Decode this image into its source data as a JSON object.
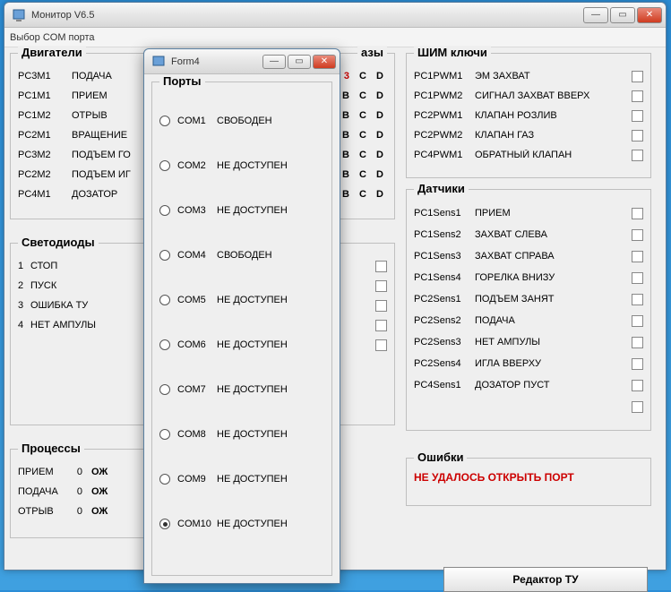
{
  "main": {
    "title": "Монитор  V6.5",
    "menu": {
      "item0": "Выбор COM порта"
    }
  },
  "engines": {
    "legend": "Двигатели",
    "items": [
      {
        "code": "PC3M1",
        "label": "ПОДАЧА"
      },
      {
        "code": "PC1M1",
        "label": "ПРИЕМ"
      },
      {
        "code": "PC1M2",
        "label": "ОТРЫВ"
      },
      {
        "code": "PC2M1",
        "label": "ВРАЩЕНИЕ"
      },
      {
        "code": "PC3M2",
        "label": "ПОДЪЕМ ГО"
      },
      {
        "code": "PC2M2",
        "label": "ПОДЪЕМ ИГ"
      },
      {
        "code": "PC4M1",
        "label": "ДОЗАТОР"
      }
    ]
  },
  "leds": {
    "legend": "Светодиоды",
    "items": [
      {
        "idx": "1",
        "label": "СТОП"
      },
      {
        "idx": "2",
        "label": "ПУСК"
      },
      {
        "idx": "3",
        "label": "ОШИБКА ТУ"
      },
      {
        "idx": "4",
        "label": "НЕТ АМПУЛЫ"
      }
    ]
  },
  "phases": {
    "legend": "азы",
    "row": "B C D",
    "row_first_red": "3 C D"
  },
  "processes": {
    "legend": "Процессы",
    "items": [
      {
        "name": "ПРИЕМ",
        "val": "0",
        "state": "ОЖ"
      },
      {
        "name": "ПОДАЧА",
        "val": "0",
        "state": "ОЖ"
      },
      {
        "name": "ОТРЫВ",
        "val": "0",
        "state": "ОЖ"
      }
    ]
  },
  "pwm": {
    "legend": "ШИМ ключи",
    "items": [
      {
        "code": "PC1PWM1",
        "label": "ЭМ ЗАХВАТ"
      },
      {
        "code": "PC1PWM2",
        "label": "СИГНАЛ ЗАХВАТ ВВЕРХ"
      },
      {
        "code": "PC2PWM1",
        "label": "КЛАПАН РОЗЛИВ"
      },
      {
        "code": "PC2PWM2",
        "label": "КЛАПАН ГАЗ"
      },
      {
        "code": "PC4PWM1",
        "label": "ОБРАТНЫЙ КЛАПАН"
      }
    ]
  },
  "sensors": {
    "legend": "Датчики",
    "items": [
      {
        "code": "PC1Sens1",
        "label": "ПРИЕМ"
      },
      {
        "code": "PC1Sens2",
        "label": "ЗАХВАТ СЛЕВА"
      },
      {
        "code": "PC1Sens3",
        "label": "ЗАХВАТ СПРАВА"
      },
      {
        "code": "PC1Sens4",
        "label": "ГОРЕЛКА ВНИЗУ"
      },
      {
        "code": "PC2Sens1",
        "label": "ПОДЪЕМ ЗАНЯТ"
      },
      {
        "code": "PC2Sens2",
        "label": "ПОДАЧА"
      },
      {
        "code": "PC2Sens3",
        "label": "НЕТ АМПУЛЫ"
      },
      {
        "code": "PC2Sens4",
        "label": "ИГЛА ВВЕРХУ"
      },
      {
        "code": "PC4Sens1",
        "label": "ДОЗАТОР ПУСТ"
      }
    ]
  },
  "errors": {
    "legend": "Ошибки",
    "message": "НЕ УДАЛОСЬ ОТКРЫТЬ ПОРТ"
  },
  "editor_btn": "Редактор ТУ",
  "dialog": {
    "title": "Form4",
    "legend": "Порты",
    "ports": [
      {
        "code": "COM1",
        "state": "СВОБОДЕН",
        "checked": false
      },
      {
        "code": "COM2",
        "state": "НЕ ДОСТУПЕН",
        "checked": false
      },
      {
        "code": "COM3",
        "state": "НЕ ДОСТУПЕН",
        "checked": false
      },
      {
        "code": "COM4",
        "state": "СВОБОДЕН",
        "checked": false
      },
      {
        "code": "COM5",
        "state": "НЕ ДОСТУПЕН",
        "checked": false
      },
      {
        "code": "COM6",
        "state": "НЕ ДОСТУПЕН",
        "checked": false
      },
      {
        "code": "COM7",
        "state": "НЕ ДОСТУПЕН",
        "checked": false
      },
      {
        "code": "COM8",
        "state": "НЕ ДОСТУПЕН",
        "checked": false
      },
      {
        "code": "COM9",
        "state": "НЕ ДОСТУПЕН",
        "checked": false
      },
      {
        "code": "COM10",
        "state": "НЕ ДОСТУПЕН",
        "checked": true
      }
    ]
  }
}
